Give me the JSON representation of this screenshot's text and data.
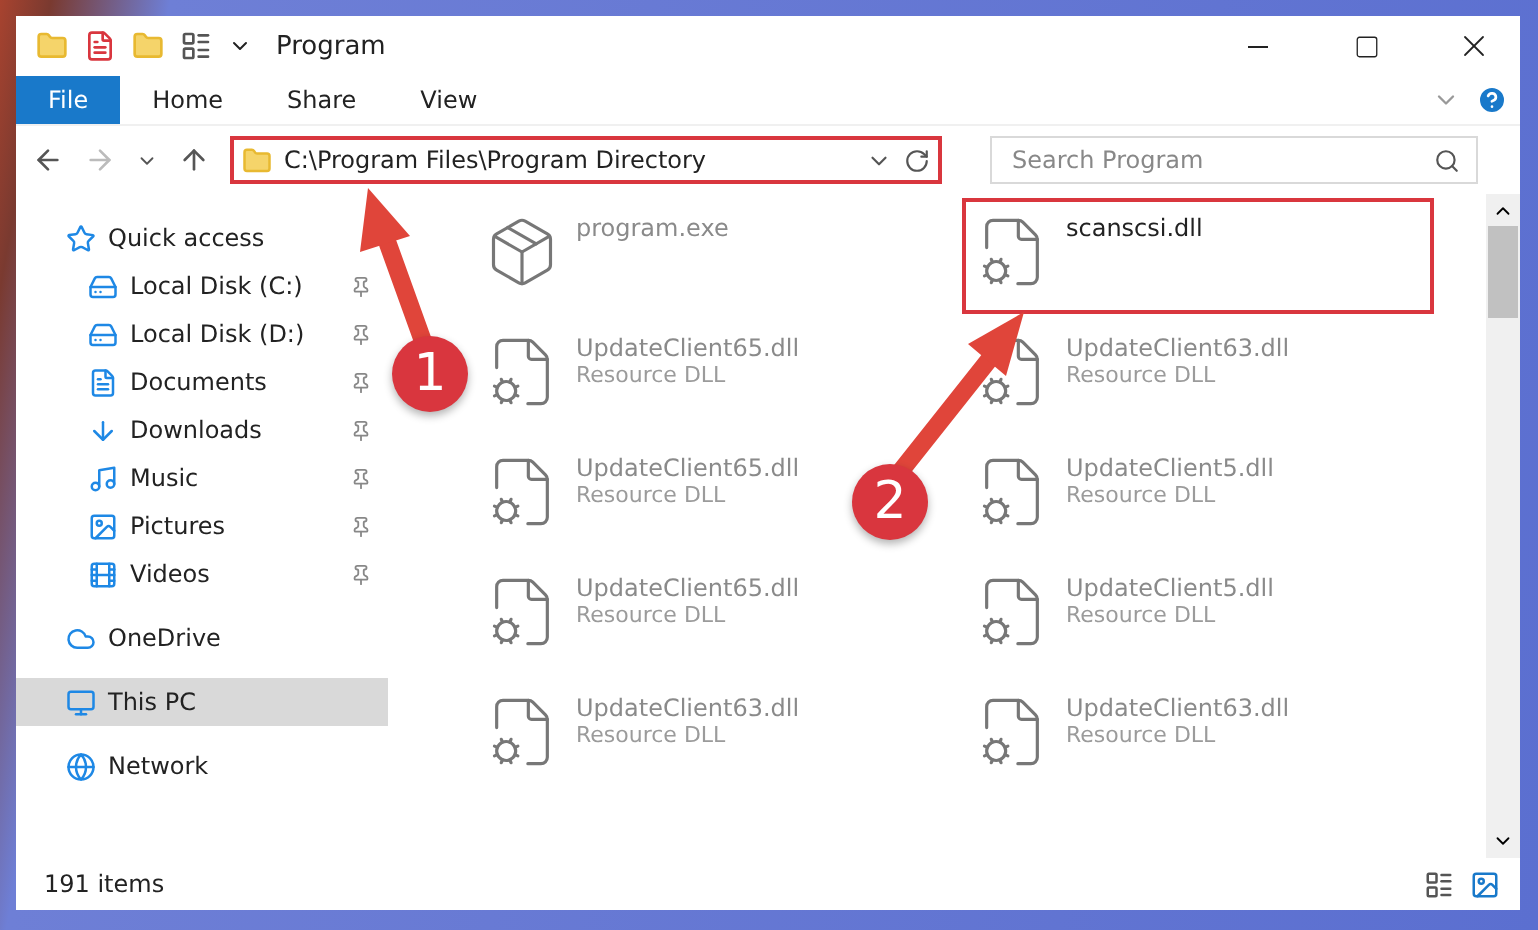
{
  "window": {
    "title": "Program"
  },
  "ribbon_tabs": [
    {
      "label": "File",
      "kind": "file"
    },
    {
      "label": "Home",
      "kind": "tab"
    },
    {
      "label": "Share",
      "kind": "tab"
    },
    {
      "label": "View",
      "kind": "tab"
    }
  ],
  "address": {
    "path": "C:\\Program Files\\Program Directory",
    "highlighted": true
  },
  "search": {
    "placeholder": "Search Program"
  },
  "sidebar": {
    "items": [
      {
        "label": "Quick access",
        "selected": false,
        "children": [
          {
            "label": "Local Disk (C:)",
            "selected": false,
            "pinned": true
          },
          {
            "label": "Local Disk (D:)",
            "selected": false,
            "pinned": true
          },
          {
            "label": "Documents",
            "selected": false,
            "pinned": true
          },
          {
            "label": "Downloads",
            "selected": false,
            "pinned": true
          },
          {
            "label": "Music",
            "selected": false,
            "pinned": true
          },
          {
            "label": "Pictures",
            "selected": false,
            "pinned": true
          },
          {
            "label": "Videos",
            "selected": false,
            "pinned": true
          }
        ]
      },
      {
        "label": "OneDrive",
        "selected": false
      },
      {
        "label": "This PC",
        "selected": true
      },
      {
        "label": "Network",
        "selected": false
      }
    ]
  },
  "files": [
    {
      "name": "program.exe",
      "kind": "exe",
      "faded": true,
      "highlighted": false
    },
    {
      "name": "scanscsi.dll",
      "kind": "dll",
      "faded": false,
      "highlighted": true
    },
    {
      "name": "UpdateClient65.dll",
      "type": "Resource DLL",
      "kind": "dll",
      "faded": true,
      "highlighted": false
    },
    {
      "name": "UpdateClient63.dll",
      "type": "Resource DLL",
      "kind": "dll",
      "faded": true,
      "highlighted": false
    },
    {
      "name": "UpdateClient65.dll",
      "type": "Resource DLL",
      "kind": "dll",
      "faded": true,
      "highlighted": false
    },
    {
      "name": "UpdateClient5.dll",
      "type": "Resource DLL",
      "kind": "dll",
      "faded": true,
      "highlighted": false
    },
    {
      "name": "UpdateClient65.dll",
      "type": "Resource DLL",
      "kind": "dll",
      "faded": true,
      "highlighted": false
    },
    {
      "name": "UpdateClient5.dll",
      "type": "Resource DLL",
      "kind": "dll",
      "faded": true,
      "highlighted": false
    },
    {
      "name": "UpdateClient63.dll",
      "type": "Resource DLL",
      "kind": "dll",
      "faded": true,
      "highlighted": false
    },
    {
      "name": "UpdateClient63.dll",
      "type": "Resource DLL",
      "kind": "dll",
      "faded": true,
      "highlighted": false
    }
  ],
  "markers": [
    {
      "number": "1"
    },
    {
      "number": "2"
    }
  ],
  "status_bar": {
    "count": "191 items"
  }
}
